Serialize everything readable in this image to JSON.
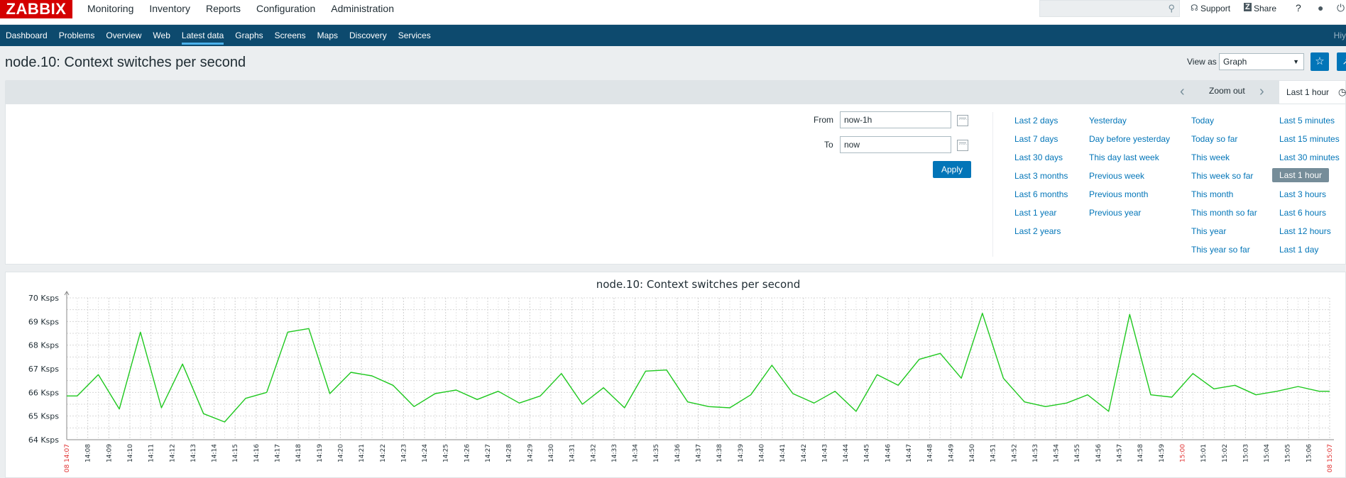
{
  "logo": "ZABBIX",
  "main_menu": [
    "Monitoring",
    "Inventory",
    "Reports",
    "Configuration",
    "Administration"
  ],
  "top_right": {
    "support": "Support",
    "share": "Share",
    "help": "?"
  },
  "sub_menu": [
    "Dashboard",
    "Problems",
    "Overview",
    "Web",
    "Latest data",
    "Graphs",
    "Screens",
    "Maps",
    "Discovery",
    "Services"
  ],
  "sub_menu_active": "Latest data",
  "sub_menu_user": "Hiy",
  "page_title": "node.10: Context switches per second",
  "view_as": {
    "label": "View as",
    "value": "Graph"
  },
  "time_tabs": {
    "zoom_out": "Zoom out",
    "current": "Last 1 hour"
  },
  "filter": {
    "from_label": "From",
    "from_value": "now-1h",
    "to_label": "To",
    "to_value": "now",
    "apply": "Apply"
  },
  "quick_ranges": {
    "col1": [
      "Last 2 days",
      "Last 7 days",
      "Last 30 days",
      "Last 3 months",
      "Last 6 months",
      "Last 1 year",
      "Last 2 years"
    ],
    "col2": [
      "Yesterday",
      "Day before yesterday",
      "This day last week",
      "Previous week",
      "Previous month",
      "Previous year"
    ],
    "col3": [
      "Today",
      "Today so far",
      "This week",
      "This week so far",
      "This month",
      "This month so far",
      "This year",
      "This year so far"
    ],
    "col4": [
      "Last 5 minutes",
      "Last 15 minutes",
      "Last 30 minutes",
      "Last 1 hour",
      "Last 3 hours",
      "Last 6 hours",
      "Last 12 hours",
      "Last 1 day"
    ],
    "selected": "Last 1 hour"
  },
  "chart_data": {
    "type": "line",
    "title": "node.10: Context switches per second",
    "y_tick_labels": [
      "64 Ksps",
      "65 Ksps",
      "66 Ksps",
      "67 Ksps",
      "68 Ksps",
      "69 Ksps",
      "70 Ksps"
    ],
    "ylim": [
      64,
      70
    ],
    "x_tick_labels": [
      "08 14:07",
      "14:08",
      "14:09",
      "14:10",
      "14:11",
      "14:12",
      "14:13",
      "14:14",
      "14:15",
      "14:16",
      "14:17",
      "14:18",
      "14:19",
      "14:20",
      "14:21",
      "14:22",
      "14:23",
      "14:24",
      "14:25",
      "14:26",
      "14:27",
      "14:28",
      "14:29",
      "14:30",
      "14:31",
      "14:32",
      "14:33",
      "14:34",
      "14:35",
      "14:36",
      "14:37",
      "14:38",
      "14:39",
      "14:40",
      "14:41",
      "14:42",
      "14:43",
      "14:44",
      "14:45",
      "14:46",
      "14:47",
      "14:48",
      "14:49",
      "14:50",
      "14:51",
      "14:52",
      "14:53",
      "14:54",
      "14:55",
      "14:56",
      "14:57",
      "14:58",
      "14:59",
      "15:00",
      "15:01",
      "15:02",
      "15:03",
      "15:04",
      "15:05",
      "15:06",
      "08 15:07"
    ],
    "red_tick_labels": [
      "08 14:07",
      "15:00",
      "08 15:07"
    ],
    "x_minutes": [
      0,
      0.5,
      1.5,
      2.5,
      3.5,
      4.5,
      5.5,
      6.5,
      7.5,
      8.5,
      9.5,
      10.5,
      11.5,
      12.5,
      13.5,
      14.5,
      15.5,
      16.5,
      17.5,
      18.5,
      19.5,
      20.5,
      21.5,
      22.5,
      23.5,
      24.5,
      25.5,
      26.5,
      27.5,
      28.5,
      29.5,
      30.5,
      31.5,
      32.5,
      33.5,
      34.5,
      35.5,
      36.5,
      37.5,
      38.5,
      39.5,
      40.5,
      41.5,
      42.5,
      43.5,
      44.5,
      45.5,
      46.5,
      47.5,
      48.5,
      49.5,
      50.5,
      51.5,
      52.5,
      53.5,
      54.5,
      55.5,
      56.5,
      57.5,
      58.5,
      59.5,
      60
    ],
    "series": [
      {
        "color": "#1ec81e",
        "values": [
          65.85,
          65.85,
          66.75,
          65.3,
          68.55,
          65.35,
          67.2,
          65.1,
          64.75,
          65.75,
          66.0,
          68.55,
          68.7,
          65.95,
          66.85,
          66.7,
          66.3,
          65.4,
          65.95,
          66.1,
          65.7,
          66.05,
          65.55,
          65.85,
          66.8,
          65.5,
          66.2,
          65.35,
          66.9,
          66.95,
          65.6,
          65.4,
          65.35,
          65.9,
          67.15,
          65.95,
          65.55,
          66.05,
          65.2,
          66.75,
          66.3,
          67.4,
          67.65,
          66.6,
          69.35,
          66.6,
          65.6,
          65.4,
          65.55,
          65.9,
          65.2,
          69.3,
          65.9,
          65.8,
          66.8,
          66.15,
          66.3,
          65.9,
          66.05,
          66.25,
          66.05,
          66.05
        ]
      }
    ]
  }
}
